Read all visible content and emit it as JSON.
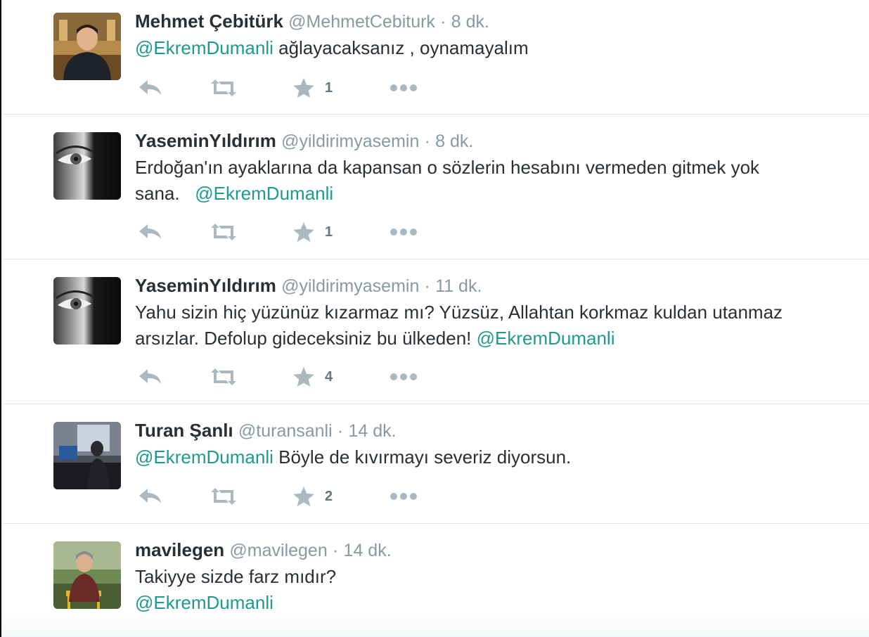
{
  "colors": {
    "mention": "#1d9a8f",
    "meta": "#8899a6",
    "icon": "#aab8c2",
    "divider": "#e1e8ed"
  },
  "tweets": [
    {
      "name": "Mehmet Çebitürk",
      "handle": "@MehmetCebiturk",
      "separator": "·",
      "time": "8 dk.",
      "line1_mention": "@EkremDumanli",
      "line1_text": " ağlayacaksanız , oynamayalım",
      "favorites": "1",
      "avatar_icon": "user-photo-icon"
    },
    {
      "name": "YaseminYıldırım",
      "handle": "@yildirimyasemin",
      "separator": "·",
      "time": "8 dk.",
      "line1_text": "Erdoğan'ın ayaklarına da kapansan o sözlerin hesabını vermeden gitmek yok",
      "line2_text": "sana.   ",
      "line2_mention": "@EkremDumanli",
      "favorites": "1",
      "avatar_icon": "eye-photo-icon"
    },
    {
      "name": "YaseminYıldırım",
      "handle": "@yildirimyasemin",
      "separator": "·",
      "time": "11 dk.",
      "line1_text": "Yahu sizin hiç yüzünüz kızarmaz mı? Yüzsüz, Allahtan korkmaz kuldan utanmaz",
      "line2_text": "arsızlar. Defolup gideceksiniz bu ülkeden! ",
      "line2_mention": "@EkremDumanli",
      "favorites": "4",
      "avatar_icon": "eye-photo-icon"
    },
    {
      "name": "Turan Şanlı",
      "handle": "@turansanli",
      "separator": "·",
      "time": "14 dk.",
      "line1_mention": "@EkremDumanli",
      "line1_text": " Böyle de kıvırmayı severiz diyorsun.",
      "favorites": "2",
      "avatar_icon": "office-photo-icon"
    },
    {
      "name": "mavilegen",
      "handle": "@mavilegen",
      "separator": "·",
      "time": "14 dk.",
      "line1_text": "Takiyye sizde farz mıdır?",
      "line2_mention": "@EkremDumanli",
      "avatar_icon": "user-photo-icon"
    }
  ]
}
